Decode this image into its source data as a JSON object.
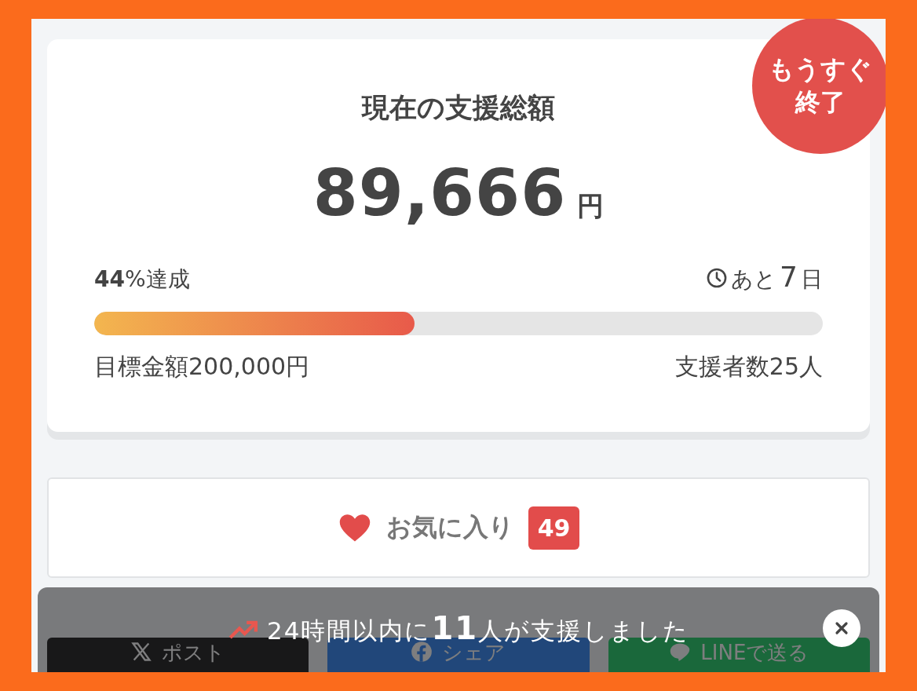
{
  "card": {
    "title": "現在の支援総額",
    "amount": "89,666",
    "currency": "円",
    "badge": [
      "もうすぐ",
      "終了"
    ],
    "achievement": {
      "value": "44",
      "unit": "%達成"
    },
    "remaining": {
      "prefix": "あと",
      "value": "7",
      "unit": "日"
    },
    "progress": {
      "level": 0.44
    },
    "goal": "目標金額200,000円",
    "backers": "支援者数25人"
  },
  "favorite": {
    "label": "お気に入り",
    "count": "49"
  },
  "share_buttons": [
    {
      "kind": "x",
      "label": "ポスト"
    },
    {
      "kind": "facebook",
      "label": "シェア"
    },
    {
      "kind": "line",
      "label": "LINEで送る"
    }
  ],
  "toast": {
    "text": "24時間以内に**11**人が支援しました"
  }
}
